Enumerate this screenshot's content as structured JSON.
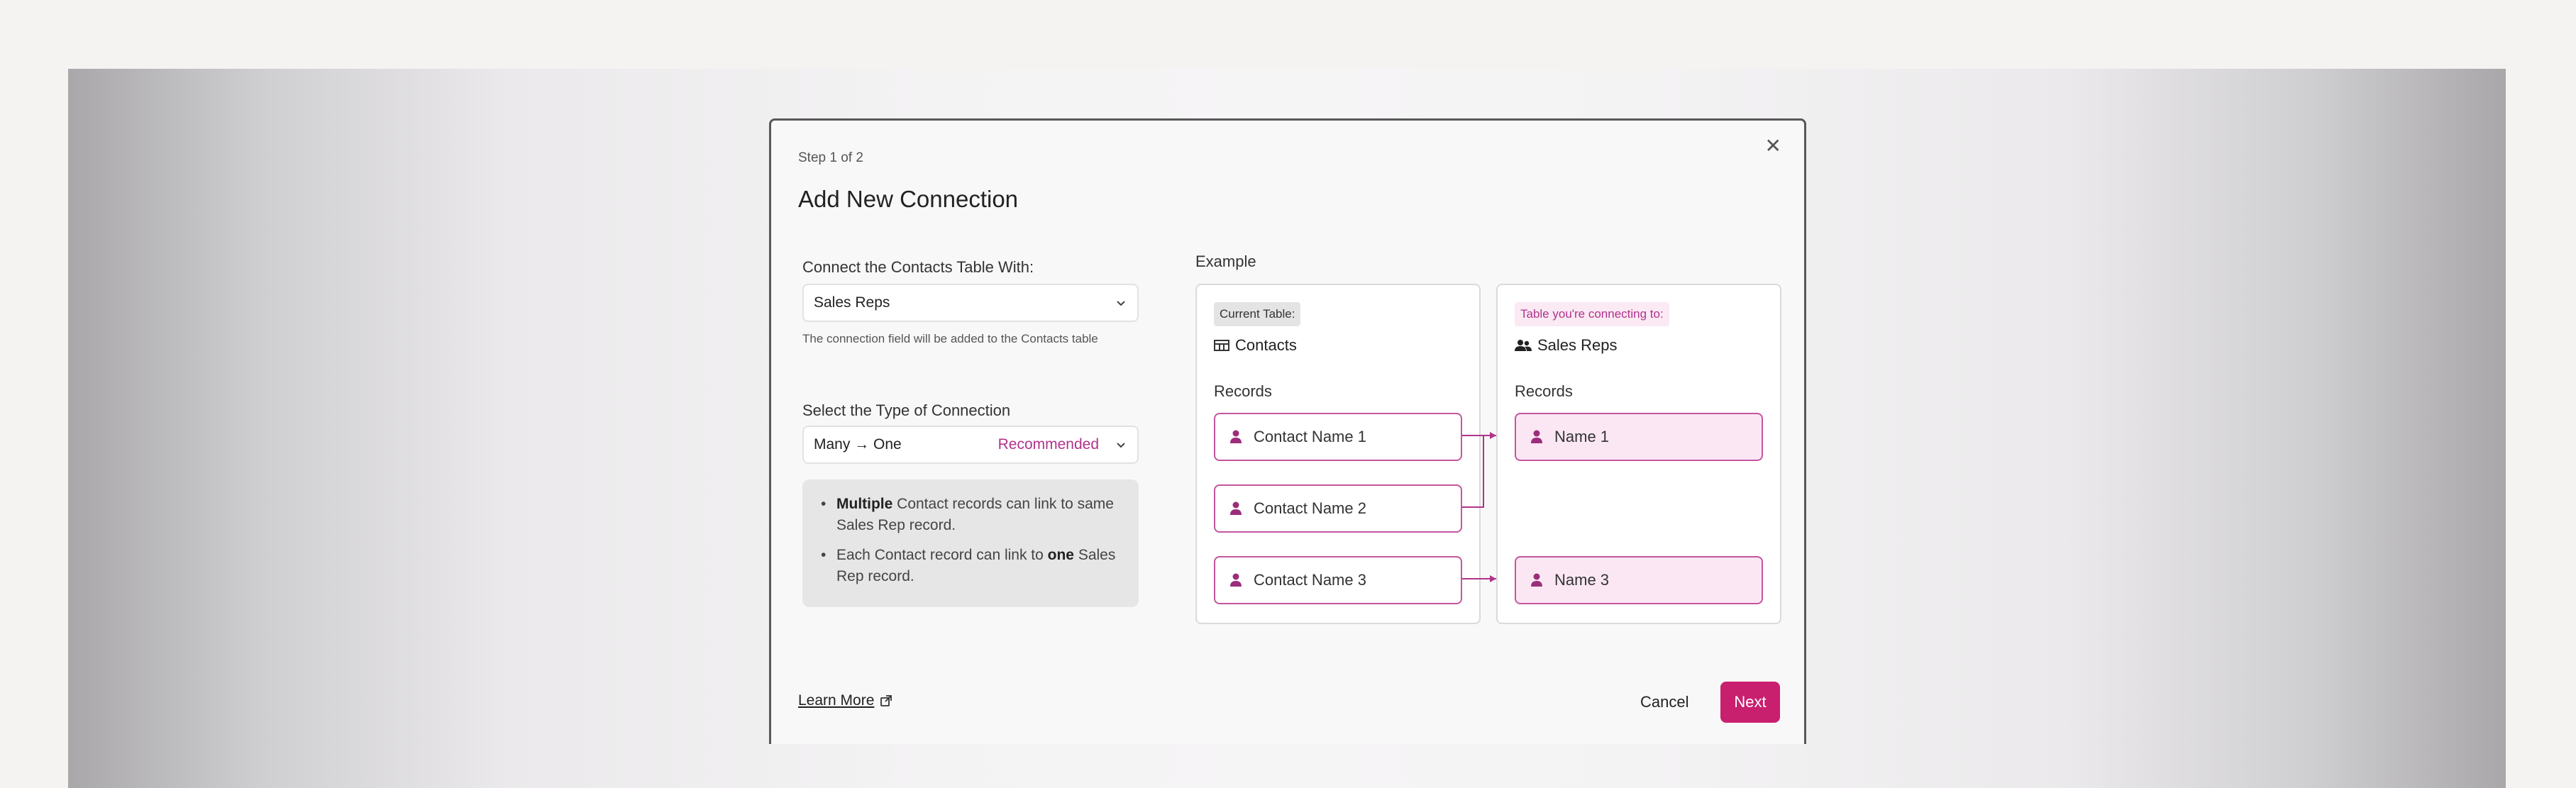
{
  "modal": {
    "step": "Step 1 of 2",
    "title": "Add New Connection",
    "close_icon": "close-icon"
  },
  "connect": {
    "label": "Connect the Contacts Table With:",
    "value": "Sales Reps",
    "hint": "The connection field will be added to the Contacts table"
  },
  "type": {
    "label": "Select the Type of Connection",
    "value": "Many → One",
    "badge": "Recommended"
  },
  "info": {
    "item1_bold": "Multiple",
    "item1_text": " Contact records can link to same Sales Rep record.",
    "item2_text": "Each Contact record can link to ",
    "item2_bold": "one",
    "item2_tail": " Sales Rep record."
  },
  "example": {
    "label": "Example",
    "current": {
      "chip": "Current Table:",
      "name": "Contacts",
      "records_label": "Records",
      "records": [
        "Contact Name 1",
        "Contact Name 2",
        "Contact Name 3"
      ]
    },
    "target": {
      "chip": "Table you're connecting to:",
      "name": "Sales Reps",
      "records_label": "Records",
      "records": [
        "Name 1",
        "Name 3"
      ]
    }
  },
  "footer": {
    "learn_more": "Learn More",
    "cancel": "Cancel",
    "next": "Next"
  },
  "colors": {
    "accent": "#c91f6f",
    "pink_text": "#b0338c",
    "pink_border": "#c4569f"
  }
}
